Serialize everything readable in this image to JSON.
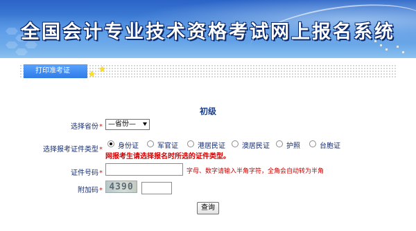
{
  "banner": {
    "title": "全国会计专业技术资格考试网上报名系统"
  },
  "tab": {
    "label": "打印准考证"
  },
  "form": {
    "heading": "初级",
    "province": {
      "label": "选择省份",
      "required_mark": "*",
      "selected": "—省份—"
    },
    "id_type": {
      "label": "选择报考证件类型",
      "required_mark": "*",
      "options": [
        "身份证",
        "军官证",
        "港居民证",
        "澳居民证",
        "护照",
        "台胞证"
      ],
      "selected_index": 0,
      "warning": "网报考生请选择报名时所选的证件类型。"
    },
    "id_number": {
      "label": "证件号码",
      "required_mark": "*",
      "value": "",
      "hint": "字母、数字请输入半角字符，全角会自动转为半角"
    },
    "captcha": {
      "label": "附加码",
      "required_mark": "*",
      "image_text": "4390",
      "value": ""
    },
    "submit_label": "查询"
  },
  "colors": {
    "tab": "#2f7ce6",
    "warning": "#d10000",
    "label": "#1a2f6e"
  }
}
